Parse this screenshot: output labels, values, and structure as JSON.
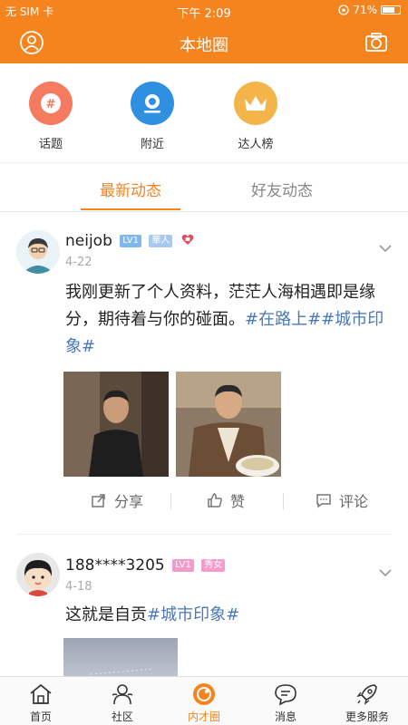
{
  "status": {
    "carrier": "无 SIM 卡",
    "time": "下午 2:09",
    "battery": "71%",
    "battery_level": 0.71
  },
  "navbar": {
    "title": "本地圈",
    "left_icon": "user-icon",
    "right_icon": "camera-icon"
  },
  "quick": [
    {
      "label": "话题",
      "icon": "hash-icon",
      "color": "#f47b60"
    },
    {
      "label": "附近",
      "icon": "location-icon",
      "color": "#2f8fe0"
    },
    {
      "label": "达人榜",
      "icon": "crown-icon",
      "color": "#f3b54a"
    }
  ],
  "tabs": [
    {
      "label": "最新动态",
      "active": true
    },
    {
      "label": "好友动态",
      "active": false
    }
  ],
  "posts": [
    {
      "username": "neijob",
      "level": "LV1",
      "tag": "華人",
      "date": "4-22",
      "text_plain": "我刚更新了个人资料，茫茫人海相遇即是缘分，期待着与你的碰面。",
      "hashtags": "#在路上##城市印象#",
      "actions": {
        "share": "分享",
        "like": "赞",
        "comment": "评论"
      }
    },
    {
      "username": "188****3205",
      "level": "LV1",
      "tag": "秀女",
      "date": "4-18",
      "text_plain": "这就是自贡",
      "hashtags": "#城市印象#"
    }
  ],
  "bottom_nav": [
    {
      "label": "首页",
      "icon": "home-icon",
      "active": false
    },
    {
      "label": "社区",
      "icon": "community-icon",
      "active": false
    },
    {
      "label": "内才圈",
      "icon": "circle-icon",
      "active": true
    },
    {
      "label": "消息",
      "icon": "message-icon",
      "active": false
    },
    {
      "label": "更多服务",
      "icon": "rocket-icon",
      "active": false
    }
  ],
  "colors": {
    "brand": "#f5841f",
    "tag": "#4a78b8",
    "level_badge": "#7fb8ec",
    "tag_badge_1": "#a7c9ef",
    "tag_badge_2": "#f49bcb"
  }
}
